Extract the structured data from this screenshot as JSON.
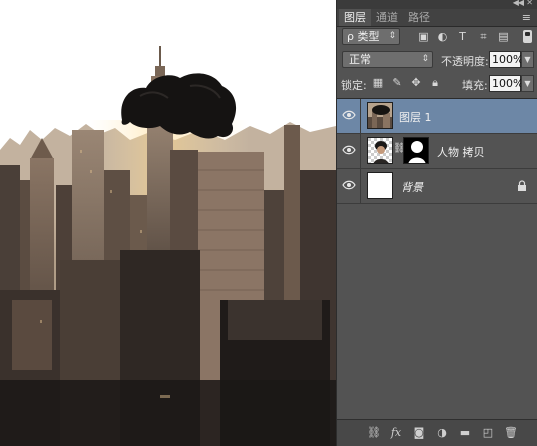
{
  "panel": {
    "tabs": [
      {
        "label": "图层",
        "active": true
      },
      {
        "label": "通道",
        "active": false
      },
      {
        "label": "路径",
        "active": false
      }
    ],
    "filter": {
      "label": "ρ 类型"
    },
    "blend_mode": "正常",
    "opacity_label": "不透明度:",
    "opacity_value": "100%",
    "lock_label": "锁定:",
    "fill_label": "填充:",
    "fill_value": "100%",
    "layers": [
      {
        "name": "图层 1",
        "selected": true,
        "visible": true
      },
      {
        "name": "人物 拷贝",
        "selected": false,
        "visible": true,
        "has_mask": true
      },
      {
        "name": "背景",
        "selected": false,
        "visible": true,
        "locked": true
      }
    ]
  },
  "colors": {
    "panel_bg": "#535353",
    "selected_layer": "#6d87a6",
    "field_bg": "#f3f3f3"
  }
}
